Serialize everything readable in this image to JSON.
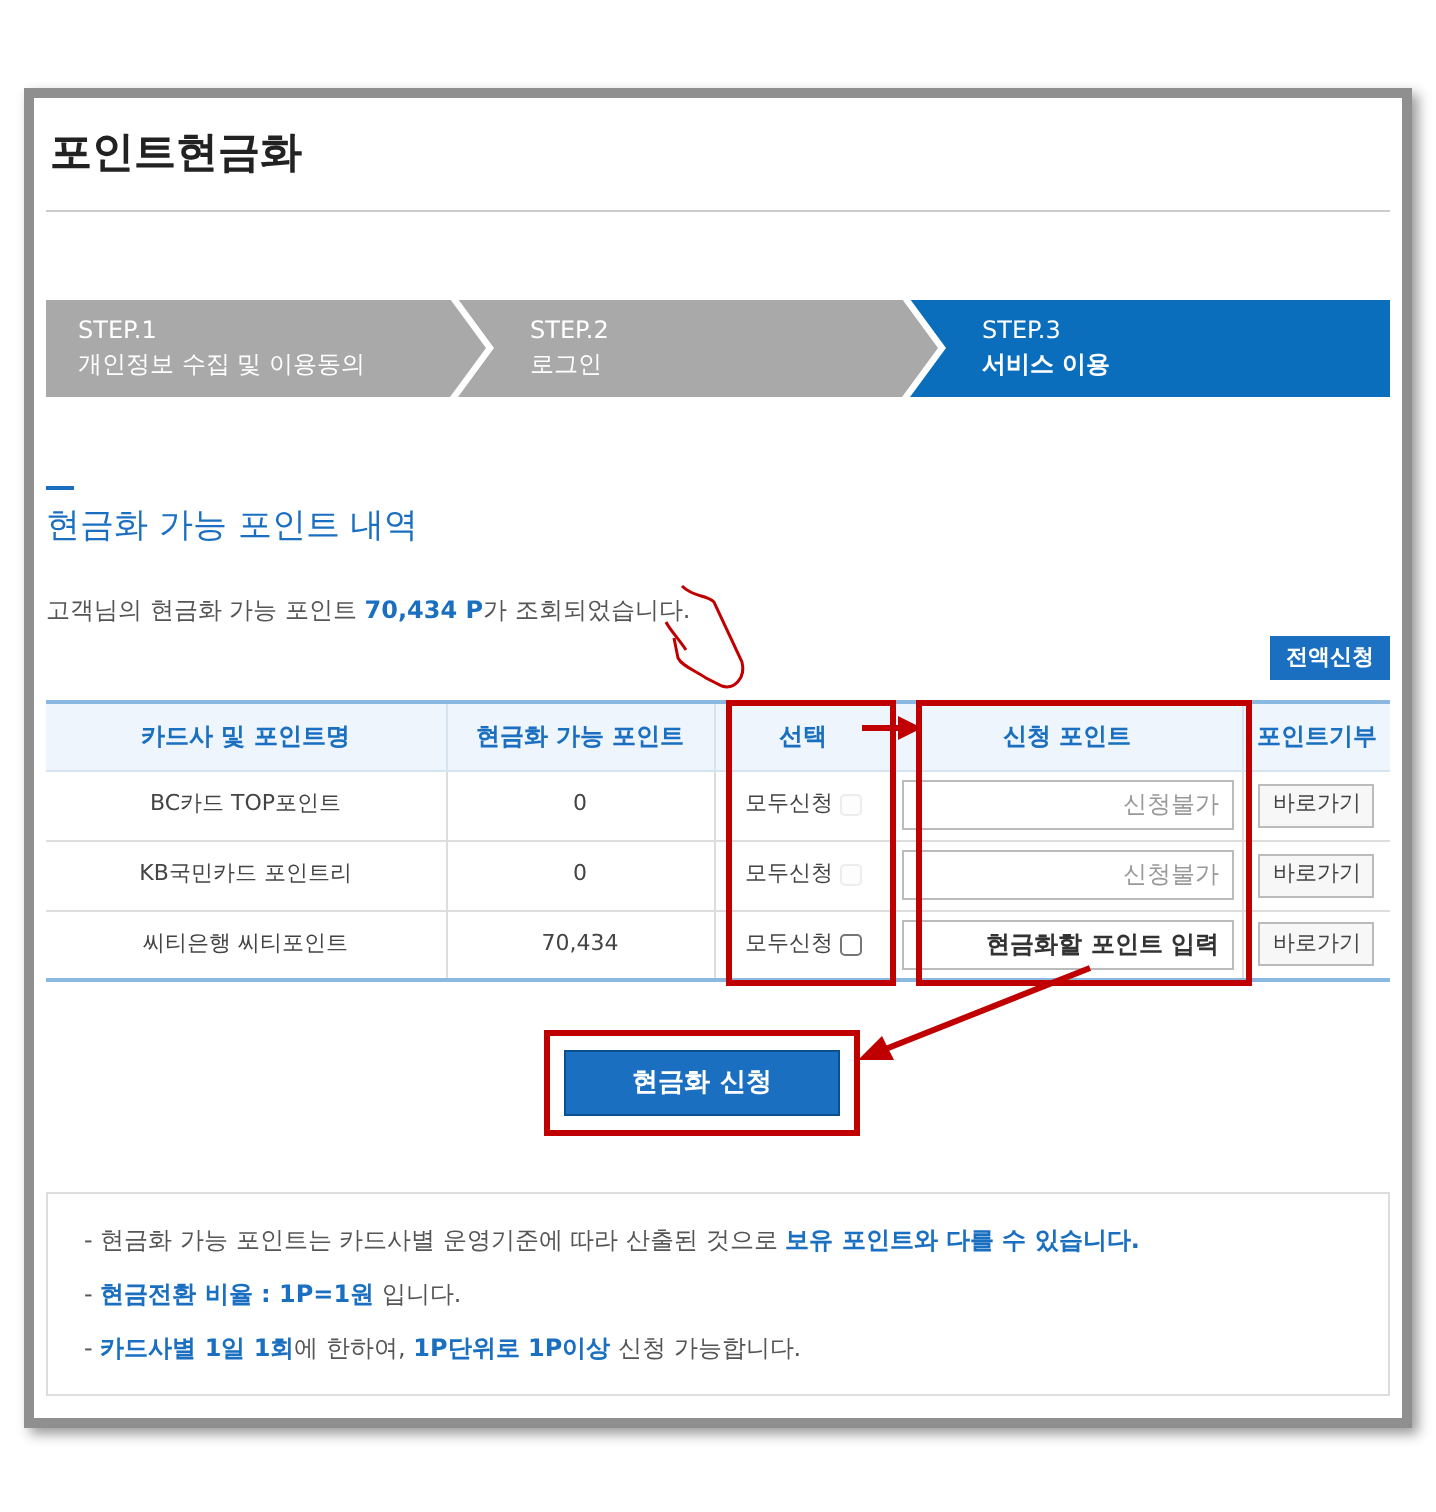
{
  "page_title": "포인트현금화",
  "steps": [
    {
      "label": "STEP.1",
      "name": "개인정보 수집 및 이용동의",
      "selected": false
    },
    {
      "label": "STEP.2",
      "name": "로그인",
      "selected": false
    },
    {
      "label": "STEP.3",
      "name": "서비스 이용",
      "selected": true
    }
  ],
  "section_title": "현금화 가능 포인트 내역",
  "intro": [
    {
      "text": "고객님의 현금화 가능 포인트 ",
      "highlight": false
    },
    {
      "text": "70,434 P",
      "highlight": true
    },
    {
      "text": "가 조회되었습니다.",
      "highlight": false
    }
  ],
  "full_apply_button": "전액신청",
  "table": {
    "columns": [
      "카드사 및 포인트명",
      "현금화 가능 포인트",
      "선택",
      "신청 포인트",
      "포인트기부"
    ],
    "rows": [
      {
        "name": "BC카드 TOP포인트",
        "points": "0",
        "select_label": "모두신청",
        "checked": false,
        "disabled": true,
        "input_value": "신청불가",
        "link": "바로가기"
      },
      {
        "name": "KB국민카드 포인트리",
        "points": "0",
        "select_label": "모두신청",
        "checked": false,
        "disabled": true,
        "input_value": "신청불가",
        "link": "바로가기"
      },
      {
        "name": "씨티은행 씨티포인트",
        "points": "70,434",
        "select_label": "모두신청",
        "checked": false,
        "disabled": false,
        "placeholder": "현금화할 포인트 입력",
        "link": "바로가기"
      }
    ]
  },
  "submit_button": "현금화 신청",
  "notes": [
    [
      {
        "text": "- 현금화 가능 포인트는 카드사별 운영기준에 따라 산출된 것으로 ",
        "highlight": false
      },
      {
        "text": "보유 포인트와 다를 수 있습니다.",
        "highlight": true
      }
    ],
    [
      {
        "text": "- ",
        "highlight": false
      },
      {
        "text": "현금전환 비율 : 1P=1원",
        "highlight": true
      },
      {
        "text": " 입니다.",
        "highlight": false
      }
    ],
    [
      {
        "text": "- ",
        "highlight": false
      },
      {
        "text": "카드사별 1일 1회",
        "highlight": true
      },
      {
        "text": "에 한하여, ",
        "highlight": false
      },
      {
        "text": "1P단위로 1P이상",
        "highlight": true
      },
      {
        "text": " 신청 가능합니다.",
        "highlight": false
      }
    ]
  ]
}
